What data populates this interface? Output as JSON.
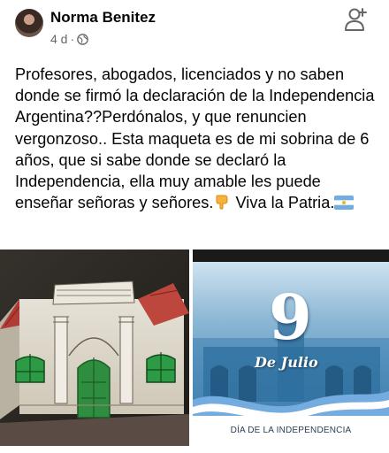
{
  "post": {
    "author": "Norma Benitez",
    "time": "4 d",
    "separator": "·",
    "text": "Profesores, abogados, licenciados y no saben donde se firmó la declaración de la Independencia Argentina??Perdónalos, y que renuncien vergonzoso.. Esta maqueta es de mi sobrina de 6 años, que si sabe donde se declaró la Independencia, ella muy amable les puede enseñar señoras y señores.",
    "text_end": " Viva la Patria.",
    "icons": {
      "privacy": "globe-icon",
      "follow": "add-friend-icon",
      "pointing": "pointing-down-emoji",
      "flag": "argentina-flag-emoji"
    }
  },
  "photos": {
    "left": {
      "description_icon": "house-model-photo"
    },
    "right": {
      "big_number": "9",
      "script_text": "De Julio",
      "caption": "DÍA DE LA INDEPENDENCIA"
    }
  },
  "colors": {
    "flag_blue": "#74acdf",
    "flag_sun": "#f6b40e",
    "secondary_text": "#65676b"
  }
}
